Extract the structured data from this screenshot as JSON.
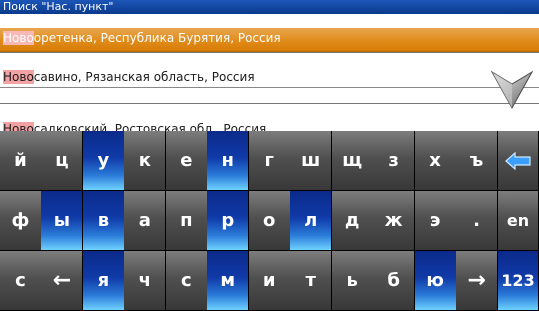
{
  "title": "Поиск \"Нас. пункт\"",
  "results": [
    {
      "highlight": "Ново",
      "rest": "оретенка, Республика Бурятия, Россия",
      "selected": true
    },
    {
      "highlight": "Ново",
      "rest": "савино, Рязанская область, Россия",
      "selected": false
    },
    {
      "highlight": "Ново",
      "rest": "садковский, Ростовская обл., Россия",
      "selected": false
    }
  ],
  "scroll_icon": "chevron-down-icon",
  "keyboard": {
    "row1": [
      "й",
      "ц",
      "у",
      "к",
      "е",
      "н",
      "г",
      "ш",
      "щ",
      "з",
      "х",
      "ъ",
      "backspace-icon"
    ],
    "row2": [
      "ф",
      "ы",
      "в",
      "а",
      "п",
      "р",
      "о",
      "л",
      "д",
      "ж",
      "э",
      ".",
      "en"
    ],
    "row3": [
      "с",
      "←",
      "я",
      "ч",
      "с",
      "м",
      "и",
      "т",
      "ь",
      "б",
      "ю",
      "→",
      "123"
    ]
  },
  "colors": {
    "selected_row": "#e08a17",
    "highlight": "#f2a2a2",
    "key_gray": "#505050",
    "key_blue": "#103aa8",
    "titlebar": "#1c56b8"
  }
}
